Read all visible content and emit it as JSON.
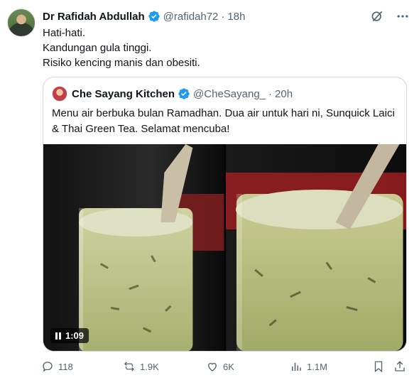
{
  "author": {
    "name": "Dr Rafidah Abdullah",
    "handle": "@rafidah72",
    "separator": "·",
    "time": "18h"
  },
  "tweet_lines": [
    "Hati-hati.",
    "Kandungan gula tinggi.",
    "Risiko kencing manis dan obesiti."
  ],
  "quoted": {
    "name": "Che Sayang Kitchen",
    "handle": "@CheSayang_",
    "separator": "·",
    "time": "20h",
    "text": "Menu air berbuka bulan Ramadhan. Dua air untuk hari ni, Sunquick Laici & Thai Green Tea. Selamat mencuba!",
    "video_duration": "1:09"
  },
  "actions": {
    "replies": "118",
    "reposts": "1.9K",
    "likes": "6K",
    "views": "1.1M"
  },
  "colors": {
    "verified": "#1d9bf0",
    "text": "#0f1419",
    "muted": "#536471",
    "border": "#cfd9de",
    "drink": "#b7c07e"
  },
  "icons": [
    "verified-icon",
    "grok-icon",
    "more-icon",
    "reply-icon",
    "repost-icon",
    "like-icon",
    "views-icon",
    "bookmark-icon",
    "share-icon",
    "pause-icon"
  ]
}
